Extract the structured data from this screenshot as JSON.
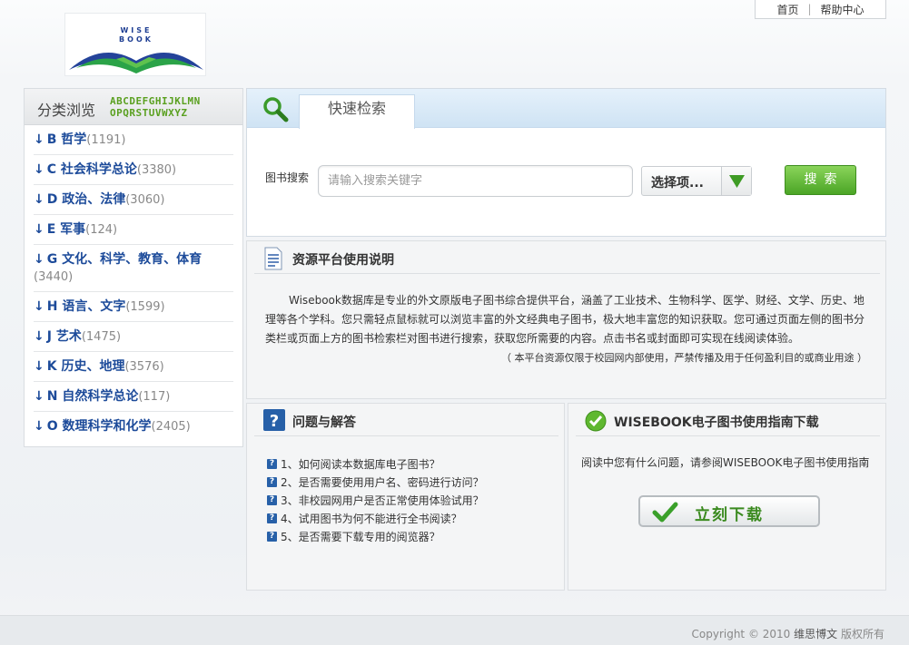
{
  "top_links": {
    "home": "首页",
    "separator": "|",
    "help": "帮助中心"
  },
  "logo": {
    "text_line1": "WISE",
    "text_line2": "BOOK"
  },
  "browse": {
    "title": "分类浏览",
    "alphabet_row1": "ABCDEFGHIJKLMN",
    "alphabet_row2": "OPQRSTUVWXYZ",
    "categories": [
      {
        "arrow": "↓",
        "name": "B 哲学",
        "count": "(1191)"
      },
      {
        "arrow": "↓",
        "name": "C 社会科学总论",
        "count": "(3380)"
      },
      {
        "arrow": "↓",
        "name": "D 政治、法律",
        "count": "(3060)"
      },
      {
        "arrow": "↓",
        "name": "E 军事",
        "count": "(124)"
      },
      {
        "arrow": "↓",
        "name": "G 文化、科学、教育、体育",
        "count": "(3440)"
      },
      {
        "arrow": "↓",
        "name": "H 语言、文字",
        "count": "(1599)"
      },
      {
        "arrow": "↓",
        "name": "J 艺术",
        "count": "(1475)"
      },
      {
        "arrow": "↓",
        "name": "K 历史、地理",
        "count": "(3576)"
      },
      {
        "arrow": "↓",
        "name": "N 自然科学总论",
        "count": "(117)"
      },
      {
        "arrow": "↓",
        "name": "O 数理科学和化学",
        "count": "(2405)"
      }
    ]
  },
  "search": {
    "tab_label": "快速检索",
    "field_label": "图书搜索",
    "placeholder": "请输入搜索关键字",
    "select_label": "选择项...",
    "button_label": "搜索"
  },
  "info": {
    "title": "资源平台使用说明",
    "body": "Wisebook数据库是专业的外文原版电子图书综合提供平台，涵盖了工业技术、生物科学、医学、财经、文学、历史、地理等各个学科。您只需轻点鼠标就可以浏览丰富的外文经典电子图书，极大地丰富您的知识获取。您可通过页面左侧的图书分类栏或页面上方的图书检索栏对图书进行搜索，获取您所需要的内容。点击书名或封面即可实现在线阅读体验。",
    "note": "（ 本平台资源仅限于校园网内部使用，严禁传播及用于任何盈利目的或商业用途 ）"
  },
  "qa": {
    "title": "问题与解答",
    "items": [
      "1、如何阅读本数据库电子图书？",
      "2、是否需要使用用户名、密码进行访问？",
      "3、非校园网用户是否正常使用体验试用？",
      "4、试用图书为何不能进行全书阅读？",
      "5、是否需要下载专用的阅览器？"
    ]
  },
  "guide": {
    "title": "WISEBOOK电子图书使用指南下载",
    "text": "阅读中您有什么问题，请参阅WISEBOOK电子图书使用指南",
    "button_label": "立刻下载"
  },
  "footer": {
    "copyright": "Copyright © 2010",
    "company": "维思博文",
    "rights": "版权所有"
  },
  "colors": {
    "link_blue": "#1d4b9a",
    "accent_green": "#4ba526",
    "header_blue": "#cfe3f4"
  }
}
